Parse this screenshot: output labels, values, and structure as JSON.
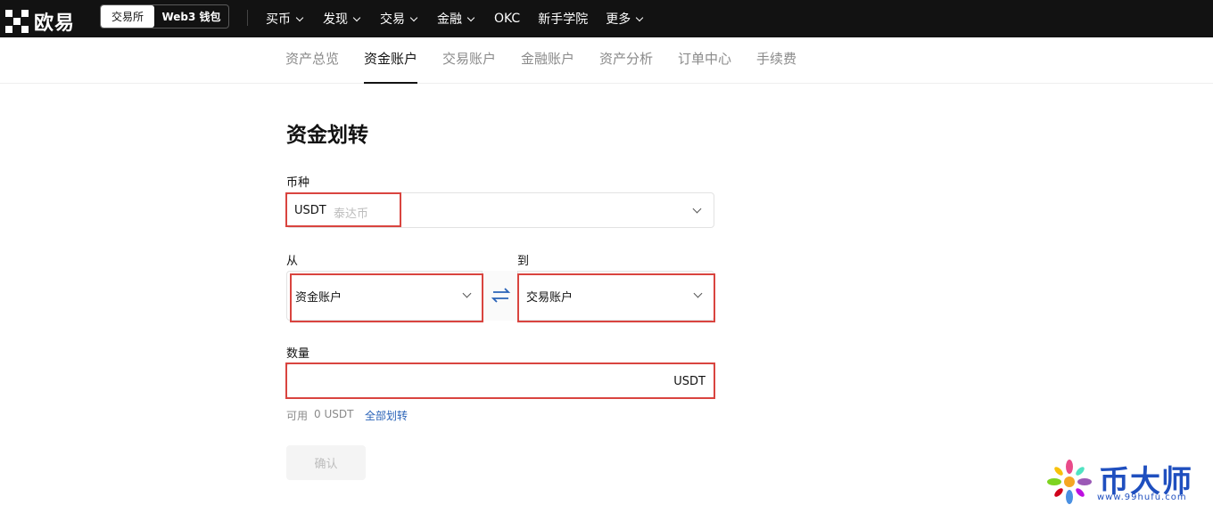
{
  "header": {
    "brand": "欧易",
    "mode_switch": {
      "active": "交易所",
      "inactive": "Web3 钱包"
    },
    "nav": [
      {
        "label": "买币",
        "has_dropdown": true
      },
      {
        "label": "发现",
        "has_dropdown": true
      },
      {
        "label": "交易",
        "has_dropdown": true
      },
      {
        "label": "金融",
        "has_dropdown": true
      },
      {
        "label": "OKC",
        "has_dropdown": false
      },
      {
        "label": "新手学院",
        "has_dropdown": false
      },
      {
        "label": "更多",
        "has_dropdown": true
      }
    ]
  },
  "subnav": {
    "tabs": [
      "资产总览",
      "资金账户",
      "交易账户",
      "金融账户",
      "资产分析",
      "订单中心",
      "手续费"
    ],
    "active_index": 1
  },
  "form": {
    "title": "资金划转",
    "coin_label": "币种",
    "coin_value": "USDT",
    "coin_name": "泰达币",
    "from_label": "从",
    "from_value": "资金账户",
    "to_label": "到",
    "to_value": "交易账户",
    "amount_label": "数量",
    "amount_unit": "USDT",
    "available_label": "可用",
    "available_value": "0 USDT",
    "transfer_all": "全部划转",
    "confirm": "确认"
  },
  "watermark": {
    "text": "币大师",
    "url": "www.99hufu.com"
  },
  "colors": {
    "topbar": "#121212",
    "highlight": "#d9443f",
    "link": "#2a63b8",
    "watermark": "#1f4fbf"
  }
}
